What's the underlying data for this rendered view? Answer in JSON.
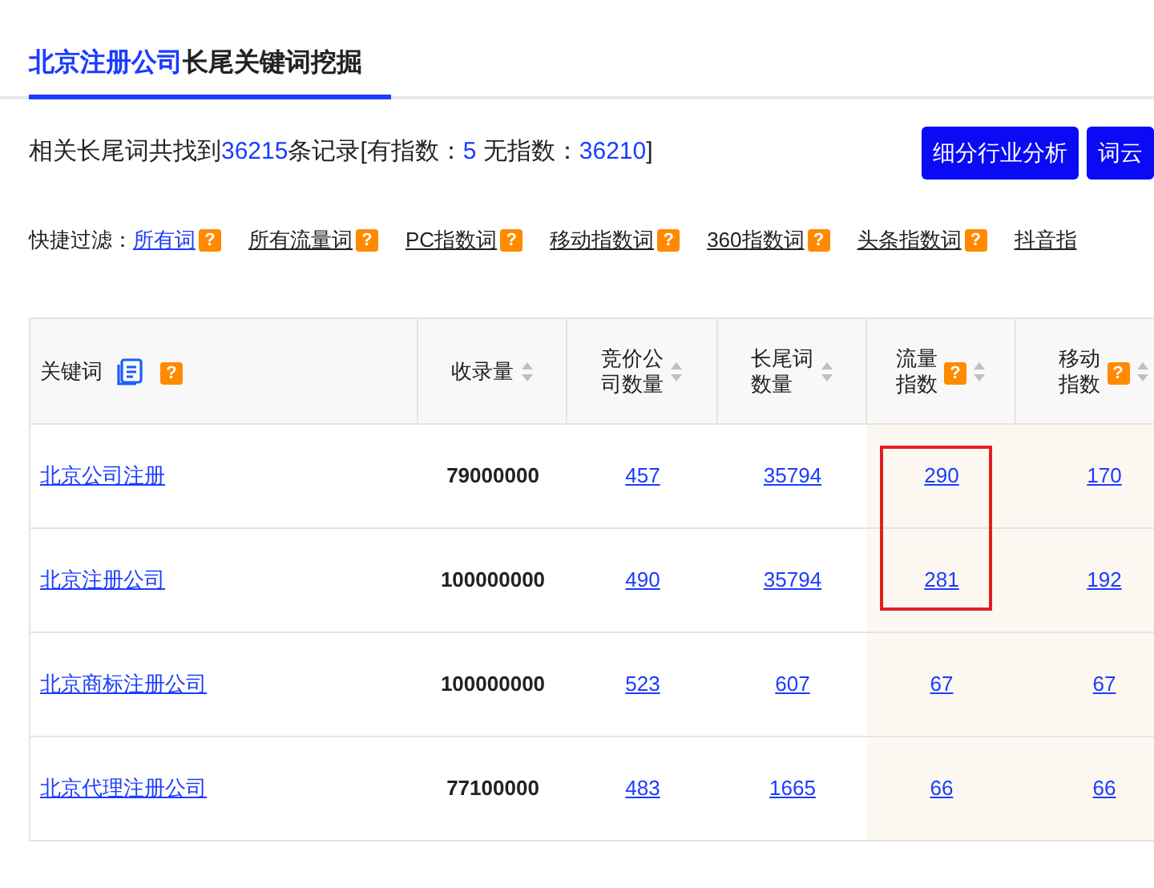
{
  "title": {
    "keyword": "北京注册公司",
    "suffix": "长尾关键词挖掘"
  },
  "summary": {
    "parts": [
      {
        "text": "相关长尾词共找到",
        "highlight": false
      },
      {
        "text": "36215",
        "highlight": true
      },
      {
        "text": "条记录[有指数：",
        "highlight": false
      },
      {
        "text": "5",
        "highlight": true
      },
      {
        "text": " 无指数：",
        "highlight": false
      },
      {
        "text": "36210",
        "highlight": true
      },
      {
        "text": "]",
        "highlight": false
      }
    ]
  },
  "buttons": [
    "细分行业分析",
    "词云"
  ],
  "filter": {
    "label": "快捷过滤：",
    "items": [
      {
        "label": "所有词",
        "selected": true,
        "help": true
      },
      {
        "label": "所有流量词",
        "selected": false,
        "help": true
      },
      {
        "label": "PC指数词",
        "selected": false,
        "help": true
      },
      {
        "label": "移动指数词",
        "selected": false,
        "help": true
      },
      {
        "label": "360指数词",
        "selected": false,
        "help": true
      },
      {
        "label": "头条指数词",
        "selected": false,
        "help": true
      },
      {
        "label": "抖音指",
        "selected": false,
        "help": false
      }
    ]
  },
  "help_mark": "?",
  "table": {
    "columns": [
      {
        "label": "关键词",
        "sortable": false,
        "help": true,
        "copy_icon": true,
        "highlighted": false
      },
      {
        "label": "收录量",
        "sortable": true,
        "help": false,
        "copy_icon": false,
        "highlighted": false
      },
      {
        "label": "竞价公司数量",
        "sortable": true,
        "help": false,
        "copy_icon": false,
        "highlighted": false
      },
      {
        "label": "长尾词数量",
        "sortable": true,
        "help": false,
        "copy_icon": false,
        "highlighted": false
      },
      {
        "label": "流量指数",
        "sortable": true,
        "help": true,
        "copy_icon": false,
        "highlighted": true
      },
      {
        "label": "移动指数",
        "sortable": true,
        "help": true,
        "copy_icon": false,
        "highlighted": true
      }
    ],
    "rows": [
      {
        "cells": [
          "北京公司注册",
          "79000000",
          "457",
          "35794",
          "290",
          "170"
        ],
        "flagged": true
      },
      {
        "cells": [
          "北京注册公司",
          "100000000",
          "490",
          "35794",
          "281",
          "192"
        ],
        "flagged": true
      },
      {
        "cells": [
          "北京商标注册公司",
          "100000000",
          "523",
          "607",
          "67",
          "67"
        ],
        "flagged": false
      },
      {
        "cells": [
          "北京代理注册公司",
          "77100000",
          "483",
          "1665",
          "66",
          "66"
        ],
        "flagged": false
      }
    ]
  }
}
